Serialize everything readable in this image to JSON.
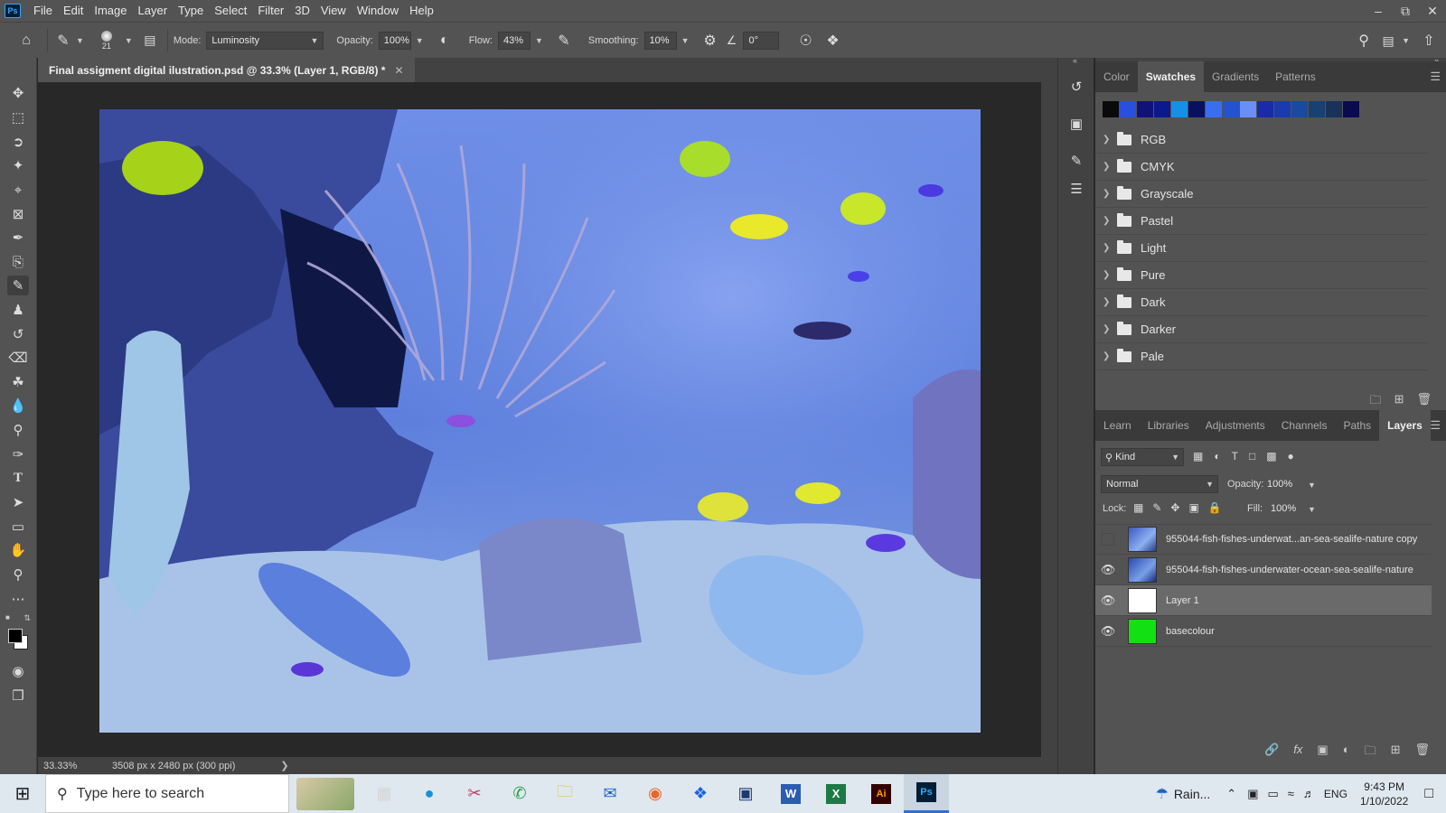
{
  "app": {
    "logo": "Ps",
    "menu": [
      "File",
      "Edit",
      "Image",
      "Layer",
      "Type",
      "Select",
      "Filter",
      "3D",
      "View",
      "Window",
      "Help"
    ],
    "window_controls": [
      "minimize-icon",
      "restore-icon",
      "close-icon"
    ]
  },
  "options_bar": {
    "brush_size": "21",
    "mode_label": "Mode:",
    "mode_value": "Luminosity",
    "opacity_label": "Opacity:",
    "opacity_value": "100%",
    "flow_label": "Flow:",
    "flow_value": "43%",
    "smoothing_label": "Smoothing:",
    "smoothing_value": "10%",
    "angle_value": "0°"
  },
  "document": {
    "tab_title": "Final assigment digital ilustration.psd @ 33.3% (Layer 1, RGB/8) *",
    "zoom": "33.33%",
    "dimensions": "3508 px x 2480 px (300 ppi)"
  },
  "swatches_panel": {
    "tabs": [
      "Color",
      "Swatches",
      "Gradients",
      "Patterns"
    ],
    "active_tab": "Swatches",
    "recent_colors": [
      "#0a0a0a",
      "#2a4fe0",
      "#10127a",
      "#0a1a8c",
      "#1490e8",
      "#0a1060",
      "#3a6ef0",
      "#2452d0",
      "#6a8ef8",
      "#1a2aa8",
      "#1a3ab0",
      "#1a4aa0",
      "#184070",
      "#18325a",
      "#0a0a50"
    ],
    "folders": [
      "RGB",
      "CMYK",
      "Grayscale",
      "Pastel",
      "Light",
      "Pure",
      "Dark",
      "Darker",
      "Pale"
    ]
  },
  "layers_panel": {
    "tabs": [
      "Learn",
      "Libraries",
      "Adjustments",
      "Channels",
      "Paths",
      "Layers"
    ],
    "active_tab": "Layers",
    "filter_kind": "Kind",
    "blend_mode": "Normal",
    "opacity_label": "Opacity:",
    "opacity_value": "100%",
    "lock_label": "Lock:",
    "fill_label": "Fill:",
    "fill_value": "100%",
    "layers": [
      {
        "name": "955044-fish-fishes-underwat...an-sea-sealife-nature copy",
        "visible": false,
        "selected": false,
        "thumb": "photo"
      },
      {
        "name": "955044-fish-fishes-underwater-ocean-sea-sealife-nature",
        "visible": true,
        "selected": false,
        "thumb": "photo"
      },
      {
        "name": "Layer 1",
        "visible": true,
        "selected": true,
        "thumb": "white"
      },
      {
        "name": "basecolour",
        "visible": true,
        "selected": false,
        "thumb": "green"
      }
    ]
  },
  "taskbar": {
    "search_placeholder": "Type here to search",
    "weather": "Rain...",
    "language": "ENG",
    "time": "9:43 PM",
    "date": "1/10/2022"
  }
}
